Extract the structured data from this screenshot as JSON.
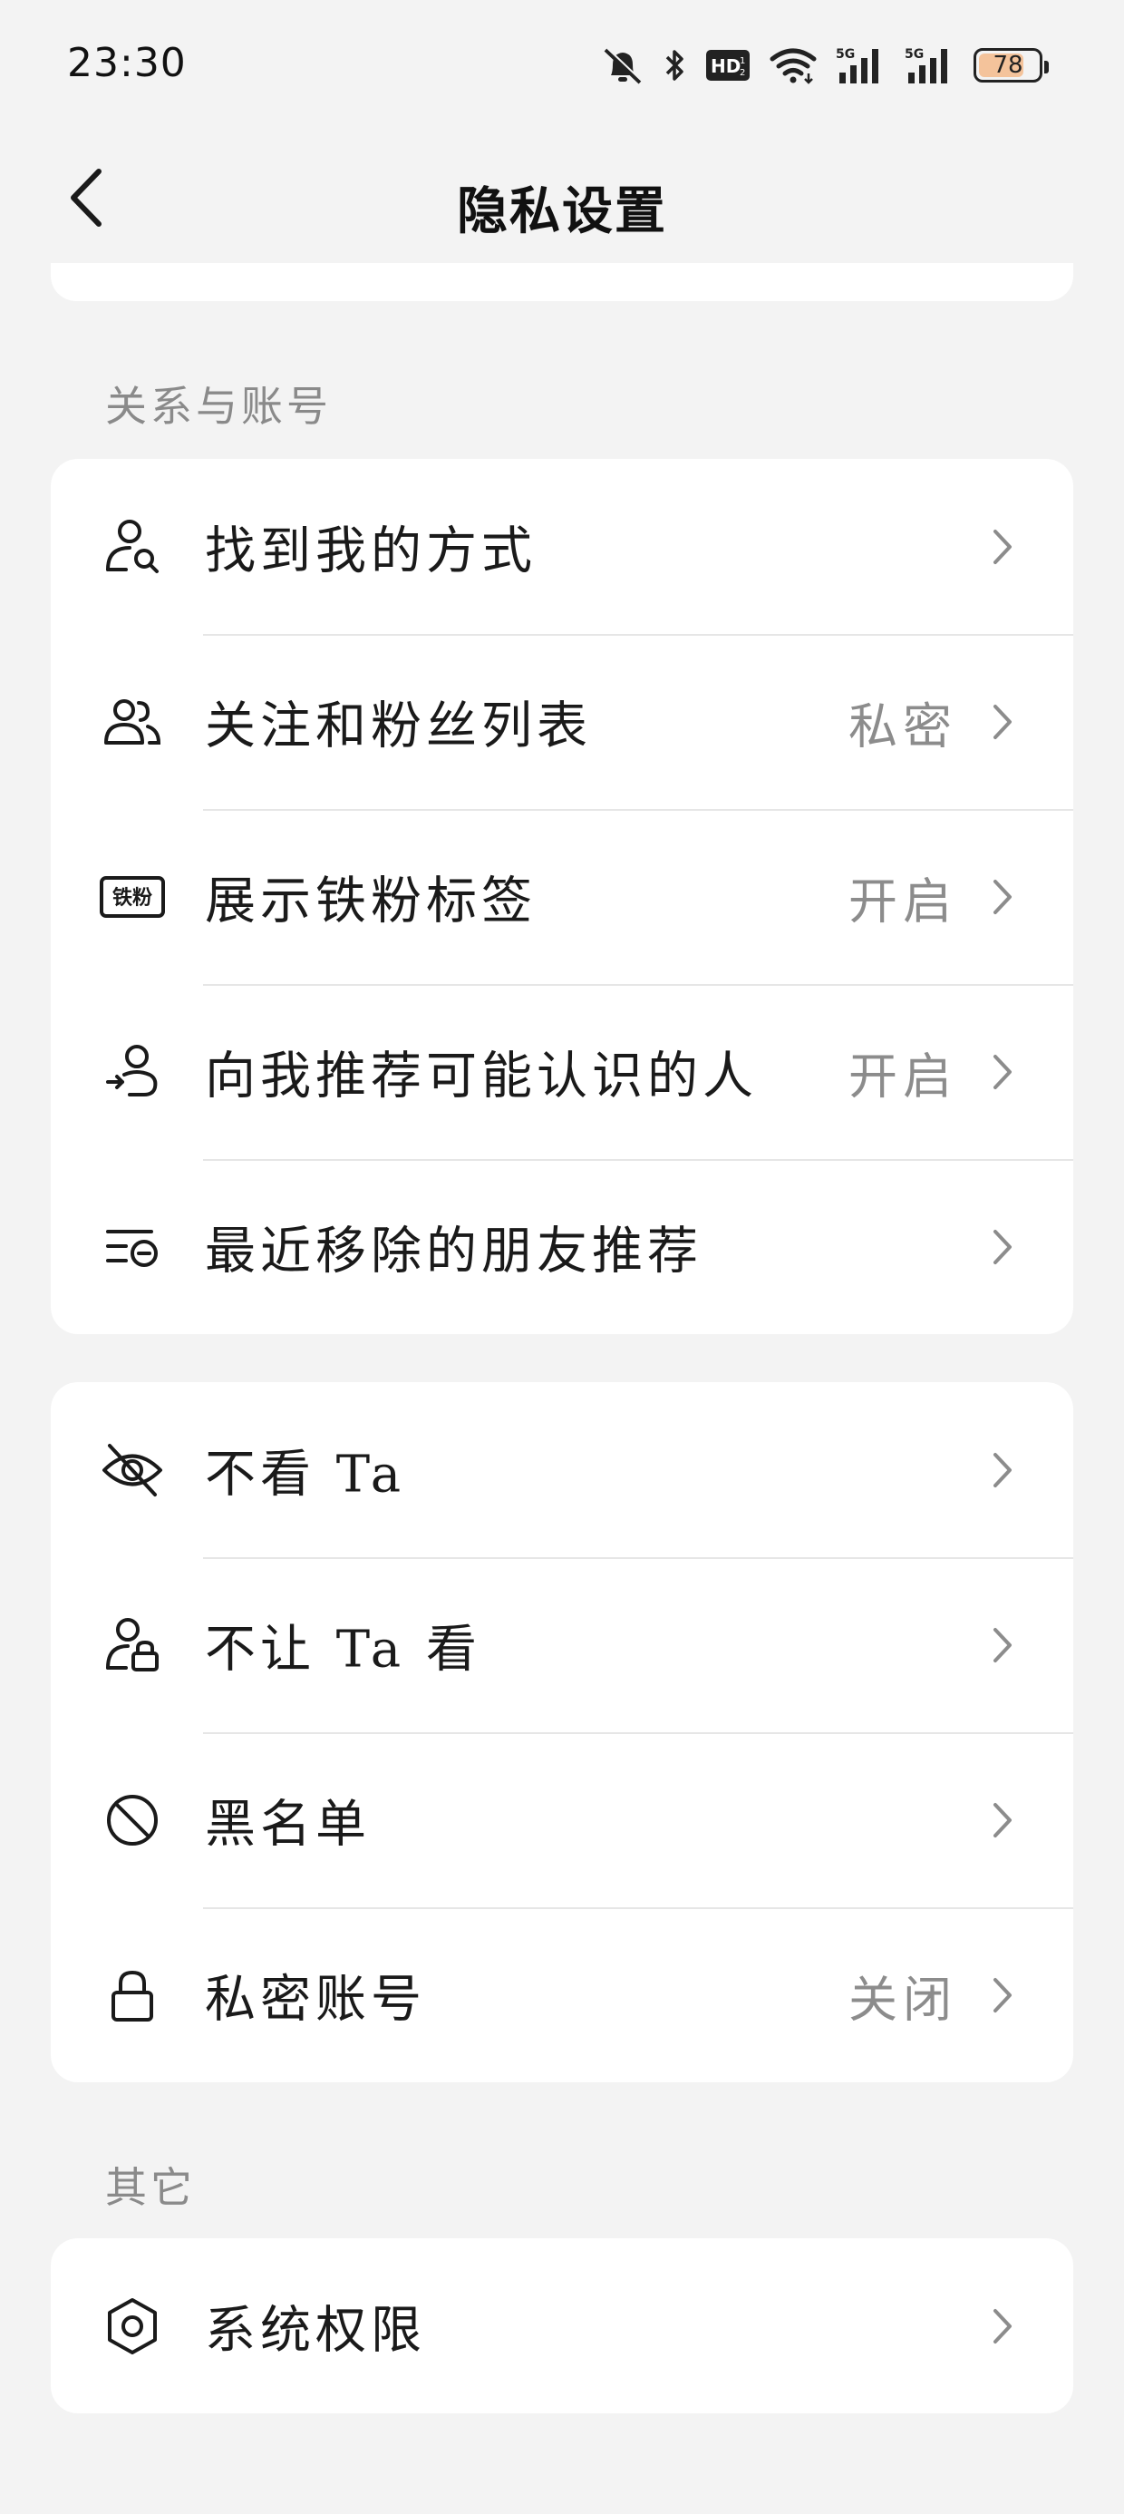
{
  "status_bar": {
    "time": "23:30",
    "battery_level": "78",
    "icons": [
      "bell-off-icon",
      "bluetooth-icon",
      "hd-icon",
      "wifi-icon",
      "signal-5g-icon",
      "signal-5g-icon",
      "battery-icon"
    ]
  },
  "nav": {
    "title": "隐私设置",
    "back_icon": "chevron-left-icon"
  },
  "sections": {
    "relations": {
      "label": "关系与账号",
      "items": [
        {
          "label": "找到我的方式",
          "value": "",
          "icon": "person-search-icon"
        },
        {
          "label": "关注和粉丝列表",
          "value": "私密",
          "icon": "people-icon"
        },
        {
          "label": "展示铁粉标签",
          "value": "开启",
          "icon": "fan-badge-icon",
          "badge_text": "铁粉"
        },
        {
          "label": "向我推荐可能认识的人",
          "value": "开启",
          "icon": "person-recommend-icon"
        },
        {
          "label": "最近移除的朋友推荐",
          "value": "",
          "icon": "list-removed-icon"
        }
      ]
    },
    "blocking": {
      "items": [
        {
          "label": "不看 Ta",
          "value": "",
          "icon": "eye-off-icon"
        },
        {
          "label": "不让 Ta 看",
          "value": "",
          "icon": "person-lock-icon"
        },
        {
          "label": "黑名单",
          "value": "",
          "icon": "ban-icon"
        },
        {
          "label": "私密账号",
          "value": "关闭",
          "icon": "lock-icon"
        }
      ]
    },
    "other": {
      "label": "其它",
      "items": [
        {
          "label": "系统权限",
          "value": "",
          "icon": "hexagon-settings-icon"
        }
      ]
    }
  },
  "colors": {
    "background": "#f3f3f3",
    "card": "#ffffff",
    "secondary_text": "#8c8c8c",
    "battery_fill": "#f4c39b"
  }
}
